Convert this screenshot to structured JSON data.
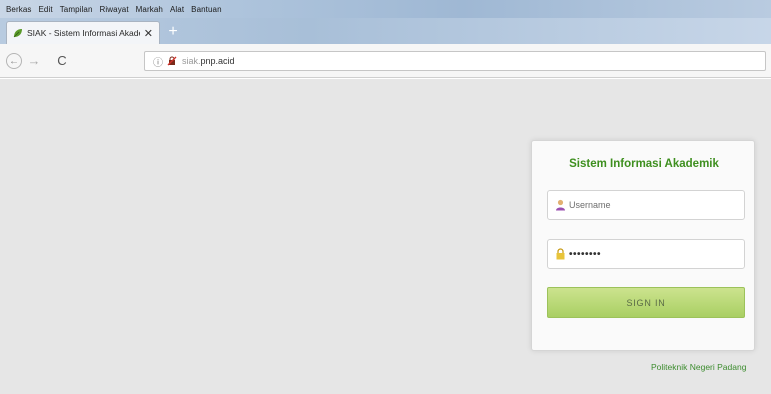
{
  "menu": {
    "items": [
      "Berkas",
      "Edit",
      "Tampilan",
      "Riwayat",
      "Markah",
      "Alat",
      "Bantuan"
    ]
  },
  "tab": {
    "title": "SIAK - Sistem Informasi Akade",
    "close_glyph": "✕",
    "favicon": "leaf-icon"
  },
  "newtab": {
    "glyph": "+"
  },
  "navbar": {
    "back_glyph": "←",
    "forward_glyph": "→",
    "reload_glyph": "C",
    "url_host_prefix": "siak.",
    "url_rest": "pnp.acid"
  },
  "login": {
    "title": "Sistem Informasi Akademik",
    "username_placeholder": "Username",
    "password_value": "••••••••",
    "signin_label": "SIGN IN"
  },
  "footer": {
    "link_text": "Politeknik Negeri Padang"
  },
  "colors": {
    "title_green": "#3e8f1f",
    "button_green": "#a9cf63",
    "page_bg": "#e6e6e6"
  }
}
